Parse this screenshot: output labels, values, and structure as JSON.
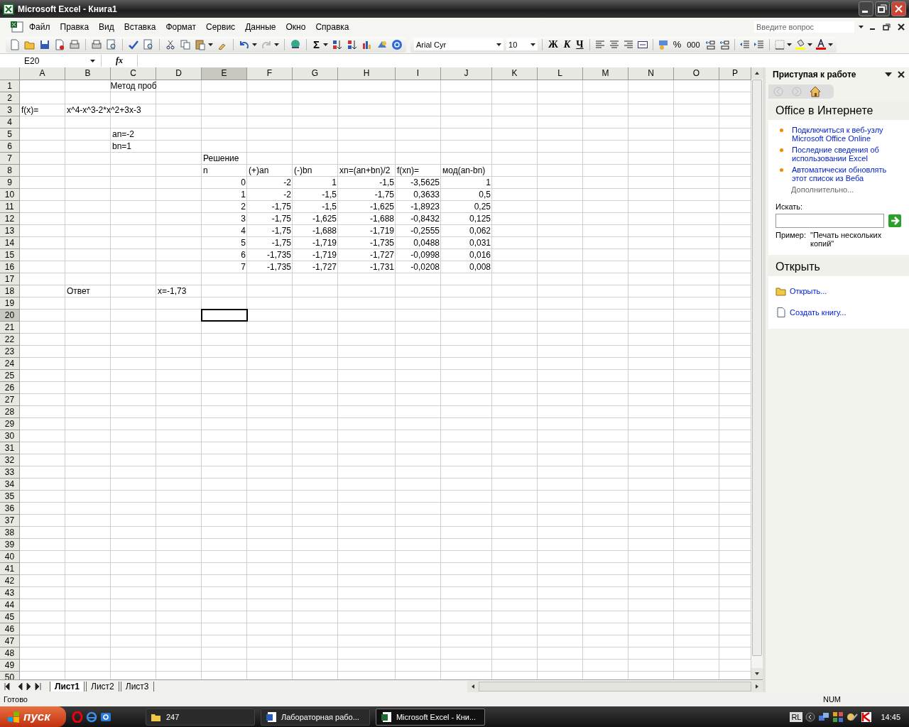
{
  "window": {
    "title": "Microsoft Excel - Книга1"
  },
  "menu": [
    {
      "label": "Файл"
    },
    {
      "label": "Правка"
    },
    {
      "label": "Вид"
    },
    {
      "label": "Вставка"
    },
    {
      "label": "Формат"
    },
    {
      "label": "Сервис"
    },
    {
      "label": "Данные"
    },
    {
      "label": "Окно"
    },
    {
      "label": "Справка"
    }
  ],
  "help_box": {
    "placeholder": "Введите вопрос"
  },
  "standard_toolbar": {
    "autosum": "Σ"
  },
  "formatting_toolbar": {
    "font": "Arial Cyr",
    "size": "10",
    "bold": "Ж",
    "italic": "К",
    "underline": "Ч",
    "percent": "%",
    "thousands": "000"
  },
  "formula_bar": {
    "name_box": "E20",
    "function_label": "fx"
  },
  "columns": [
    {
      "label": "A",
      "selected": false
    },
    {
      "label": "B",
      "selected": false
    },
    {
      "label": "C",
      "selected": false
    },
    {
      "label": "D",
      "selected": false
    },
    {
      "label": "E",
      "selected": true
    },
    {
      "label": "F",
      "selected": false
    },
    {
      "label": "G",
      "selected": false
    },
    {
      "label": "H",
      "selected": false
    },
    {
      "label": "I",
      "selected": false
    },
    {
      "label": "J",
      "selected": false
    },
    {
      "label": "K",
      "selected": false
    },
    {
      "label": "L",
      "selected": false
    },
    {
      "label": "M",
      "selected": false
    },
    {
      "label": "N",
      "selected": false
    },
    {
      "label": "O",
      "selected": false
    },
    {
      "label": "P",
      "selected": false
    }
  ],
  "rows": [
    {
      "label": "1",
      "selected": false,
      "cells": [
        null,
        null,
        {
          "text": "Метод проб",
          "kind": "title"
        }
      ]
    },
    {
      "label": "2",
      "selected": false
    },
    {
      "label": "3",
      "selected": false,
      "cells": [
        {
          "text": "f(x)=",
          "kind": "text"
        },
        {
          "text": "x^4-x^3-2*x^2+3x-3",
          "kind": "text"
        }
      ]
    },
    {
      "label": "4",
      "selected": false
    },
    {
      "label": "5",
      "selected": false,
      "cells": [
        null,
        null,
        {
          "text": "an=-2",
          "kind": "text"
        }
      ]
    },
    {
      "label": "6",
      "selected": false,
      "cells": [
        null,
        null,
        {
          "text": "bn=1",
          "kind": "text"
        }
      ]
    },
    {
      "label": "7",
      "selected": false,
      "cells": [
        null,
        null,
        null,
        null,
        {
          "text": "Решение",
          "kind": "text"
        }
      ]
    },
    {
      "label": "8",
      "selected": false,
      "cells": [
        null,
        null,
        null,
        null,
        {
          "text": "n",
          "kind": "text"
        },
        {
          "text": "(+)an",
          "kind": "text"
        },
        {
          "text": "(-)bn",
          "kind": "text"
        },
        {
          "text": "xn=(an+bn)/2",
          "kind": "text"
        },
        {
          "text": "f(xn)=",
          "kind": "text"
        },
        {
          "text": "мод(an-bn)",
          "kind": "text"
        }
      ]
    },
    {
      "label": "9",
      "selected": false,
      "cells": [
        null,
        null,
        null,
        null,
        {
          "text": "0",
          "kind": "number"
        },
        {
          "text": "-2",
          "kind": "number"
        },
        {
          "text": "1",
          "kind": "number"
        },
        {
          "text": "-1,5",
          "kind": "number"
        },
        {
          "text": "-3,5625",
          "kind": "number"
        },
        {
          "text": "1",
          "kind": "number"
        }
      ]
    },
    {
      "label": "10",
      "selected": false,
      "cells": [
        null,
        null,
        null,
        null,
        {
          "text": "1",
          "kind": "number"
        },
        {
          "text": "-2",
          "kind": "number"
        },
        {
          "text": "-1,5",
          "kind": "number"
        },
        {
          "text": "-1,75",
          "kind": "number"
        },
        {
          "text": "0,3633",
          "kind": "number"
        },
        {
          "text": "0,5",
          "kind": "number"
        }
      ]
    },
    {
      "label": "11",
      "selected": false,
      "cells": [
        null,
        null,
        null,
        null,
        {
          "text": "2",
          "kind": "number"
        },
        {
          "text": "-1,75",
          "kind": "number"
        },
        {
          "text": "-1,5",
          "kind": "number"
        },
        {
          "text": "-1,625",
          "kind": "number"
        },
        {
          "text": "-1,8923",
          "kind": "number"
        },
        {
          "text": "0,25",
          "kind": "number"
        }
      ]
    },
    {
      "label": "12",
      "selected": false,
      "cells": [
        null,
        null,
        null,
        null,
        {
          "text": "3",
          "kind": "number"
        },
        {
          "text": "-1,75",
          "kind": "number"
        },
        {
          "text": "-1,625",
          "kind": "number"
        },
        {
          "text": "-1,688",
          "kind": "number"
        },
        {
          "text": "-0,8432",
          "kind": "number"
        },
        {
          "text": "0,125",
          "kind": "number"
        }
      ]
    },
    {
      "label": "13",
      "selected": false,
      "cells": [
        null,
        null,
        null,
        null,
        {
          "text": "4",
          "kind": "number"
        },
        {
          "text": "-1,75",
          "kind": "number"
        },
        {
          "text": "-1,688",
          "kind": "number"
        },
        {
          "text": "-1,719",
          "kind": "number"
        },
        {
          "text": "-0,2555",
          "kind": "number"
        },
        {
          "text": "0,062",
          "kind": "number"
        }
      ]
    },
    {
      "label": "14",
      "selected": false,
      "cells": [
        null,
        null,
        null,
        null,
        {
          "text": "5",
          "kind": "number"
        },
        {
          "text": "-1,75",
          "kind": "number"
        },
        {
          "text": "-1,719",
          "kind": "number"
        },
        {
          "text": "-1,735",
          "kind": "number"
        },
        {
          "text": "0,0488",
          "kind": "number"
        },
        {
          "text": "0,031",
          "kind": "number"
        }
      ]
    },
    {
      "label": "15",
      "selected": false,
      "cells": [
        null,
        null,
        null,
        null,
        {
          "text": "6",
          "kind": "number"
        },
        {
          "text": "-1,735",
          "kind": "number"
        },
        {
          "text": "-1,719",
          "kind": "number"
        },
        {
          "text": "-1,727",
          "kind": "number"
        },
        {
          "text": "-0,0998",
          "kind": "number"
        },
        {
          "text": "0,016",
          "kind": "number"
        }
      ]
    },
    {
      "label": "16",
      "selected": false,
      "cells": [
        null,
        null,
        null,
        null,
        {
          "text": "7",
          "kind": "number"
        },
        {
          "text": "-1,735",
          "kind": "number"
        },
        {
          "text": "-1,727",
          "kind": "number"
        },
        {
          "text": "-1,731",
          "kind": "number"
        },
        {
          "text": "-0,0208",
          "kind": "number"
        },
        {
          "text": "0,008",
          "kind": "number"
        }
      ]
    },
    {
      "label": "17",
      "selected": false
    },
    {
      "label": "18",
      "selected": false,
      "cells": [
        null,
        {
          "text": "Ответ",
          "kind": "text"
        },
        null,
        {
          "text": "x=-1,73",
          "kind": "text"
        }
      ]
    },
    {
      "label": "19",
      "selected": false
    },
    {
      "label": "20",
      "selected": true
    },
    {
      "label": "21",
      "selected": false
    },
    {
      "label": "22",
      "selected": false
    },
    {
      "label": "23",
      "selected": false
    },
    {
      "label": "24",
      "selected": false
    },
    {
      "label": "25",
      "selected": false
    },
    {
      "label": "26",
      "selected": false
    },
    {
      "label": "27",
      "selected": false
    },
    {
      "label": "28",
      "selected": false
    },
    {
      "label": "29",
      "selected": false
    },
    {
      "label": "30",
      "selected": false
    },
    {
      "label": "31",
      "selected": false
    },
    {
      "label": "32",
      "selected": false
    },
    {
      "label": "33",
      "selected": false
    },
    {
      "label": "34",
      "selected": false
    },
    {
      "label": "35",
      "selected": false
    },
    {
      "label": "36",
      "selected": false
    },
    {
      "label": "37",
      "selected": false
    },
    {
      "label": "38",
      "selected": false
    },
    {
      "label": "39",
      "selected": false
    },
    {
      "label": "40",
      "selected": false
    },
    {
      "label": "41",
      "selected": false
    },
    {
      "label": "42",
      "selected": false
    },
    {
      "label": "43",
      "selected": false
    },
    {
      "label": "44",
      "selected": false
    },
    {
      "label": "45",
      "selected": false
    },
    {
      "label": "46",
      "selected": false
    },
    {
      "label": "47",
      "selected": false
    },
    {
      "label": "48",
      "selected": false
    },
    {
      "label": "49",
      "selected": false
    },
    {
      "label": "50",
      "selected": false
    }
  ],
  "sheet_tabs": [
    {
      "label": "Лист1",
      "selected": true
    },
    {
      "label": "Лист2",
      "selected": false
    },
    {
      "label": "Лист3",
      "selected": false
    }
  ],
  "task_pane": {
    "title": "Приступая к работе",
    "online_section": {
      "heading": "Office в Интернете",
      "links": [
        "Подключиться к веб-узлу Microsoft Office Online",
        "Последние сведения об использовании Excel",
        "Автоматически обновлять этот список из Веба"
      ],
      "more": "Дополнительно...",
      "search_label": "Искать:",
      "example_label": "Пример:",
      "example_text": "\"Печать нескольких копий\""
    },
    "open_section": {
      "heading": "Открыть",
      "items": [
        {
          "label": "Открыть...",
          "kind": "folder"
        },
        {
          "label": "Создать книгу...",
          "kind": "document"
        }
      ]
    }
  },
  "status_bar": {
    "status": "Готово",
    "indicator": "NUM"
  },
  "taskbar": {
    "start": "пуск",
    "tasks": [
      {
        "label": "247",
        "kind": "folder",
        "selected": false
      },
      {
        "label": "Лабораторная рабо...",
        "kind": "word",
        "selected": false
      },
      {
        "label": "Microsoft Excel - Кни...",
        "kind": "excel",
        "selected": true
      }
    ],
    "language": "RL",
    "clock": "14:45"
  }
}
